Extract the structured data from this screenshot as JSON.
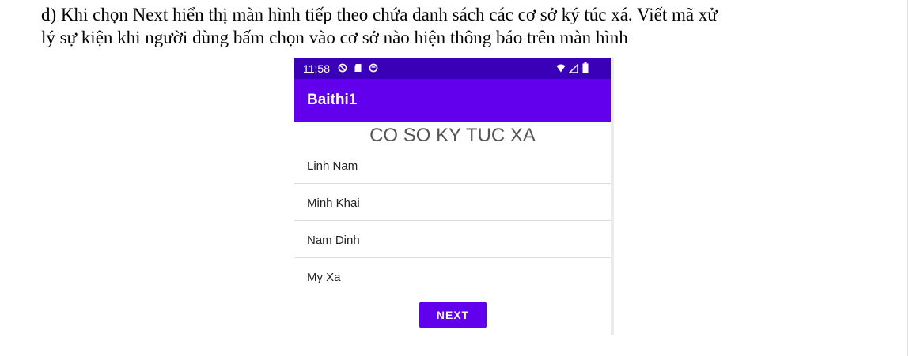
{
  "task": {
    "line1": "d) Khi chọn Next hiển thị màn hình tiếp theo chứa danh sách các cơ sở ký túc xá. Viết mã xử",
    "line2": "lý sự kiện khi người dùng bấm chọn vào cơ sở nào hiện thông báo trên màn hình"
  },
  "phone": {
    "status_bar": {
      "time": "11:58",
      "left_icons": [
        "block-icon",
        "sd-card-icon",
        "circle-icon"
      ],
      "right_icons": [
        "wifi-icon",
        "signal-icon",
        "battery-icon"
      ],
      "color": "#3a00b8"
    },
    "app_bar": {
      "title": "Baithi1",
      "color": "#6200ee"
    },
    "heading": "CO SO KY TUC XA",
    "list": {
      "items": [
        "Linh Nam",
        "Minh Khai",
        "Nam Dinh",
        "My Xa"
      ]
    },
    "next_button": {
      "label": "NEXT",
      "color": "#6200ee"
    }
  }
}
